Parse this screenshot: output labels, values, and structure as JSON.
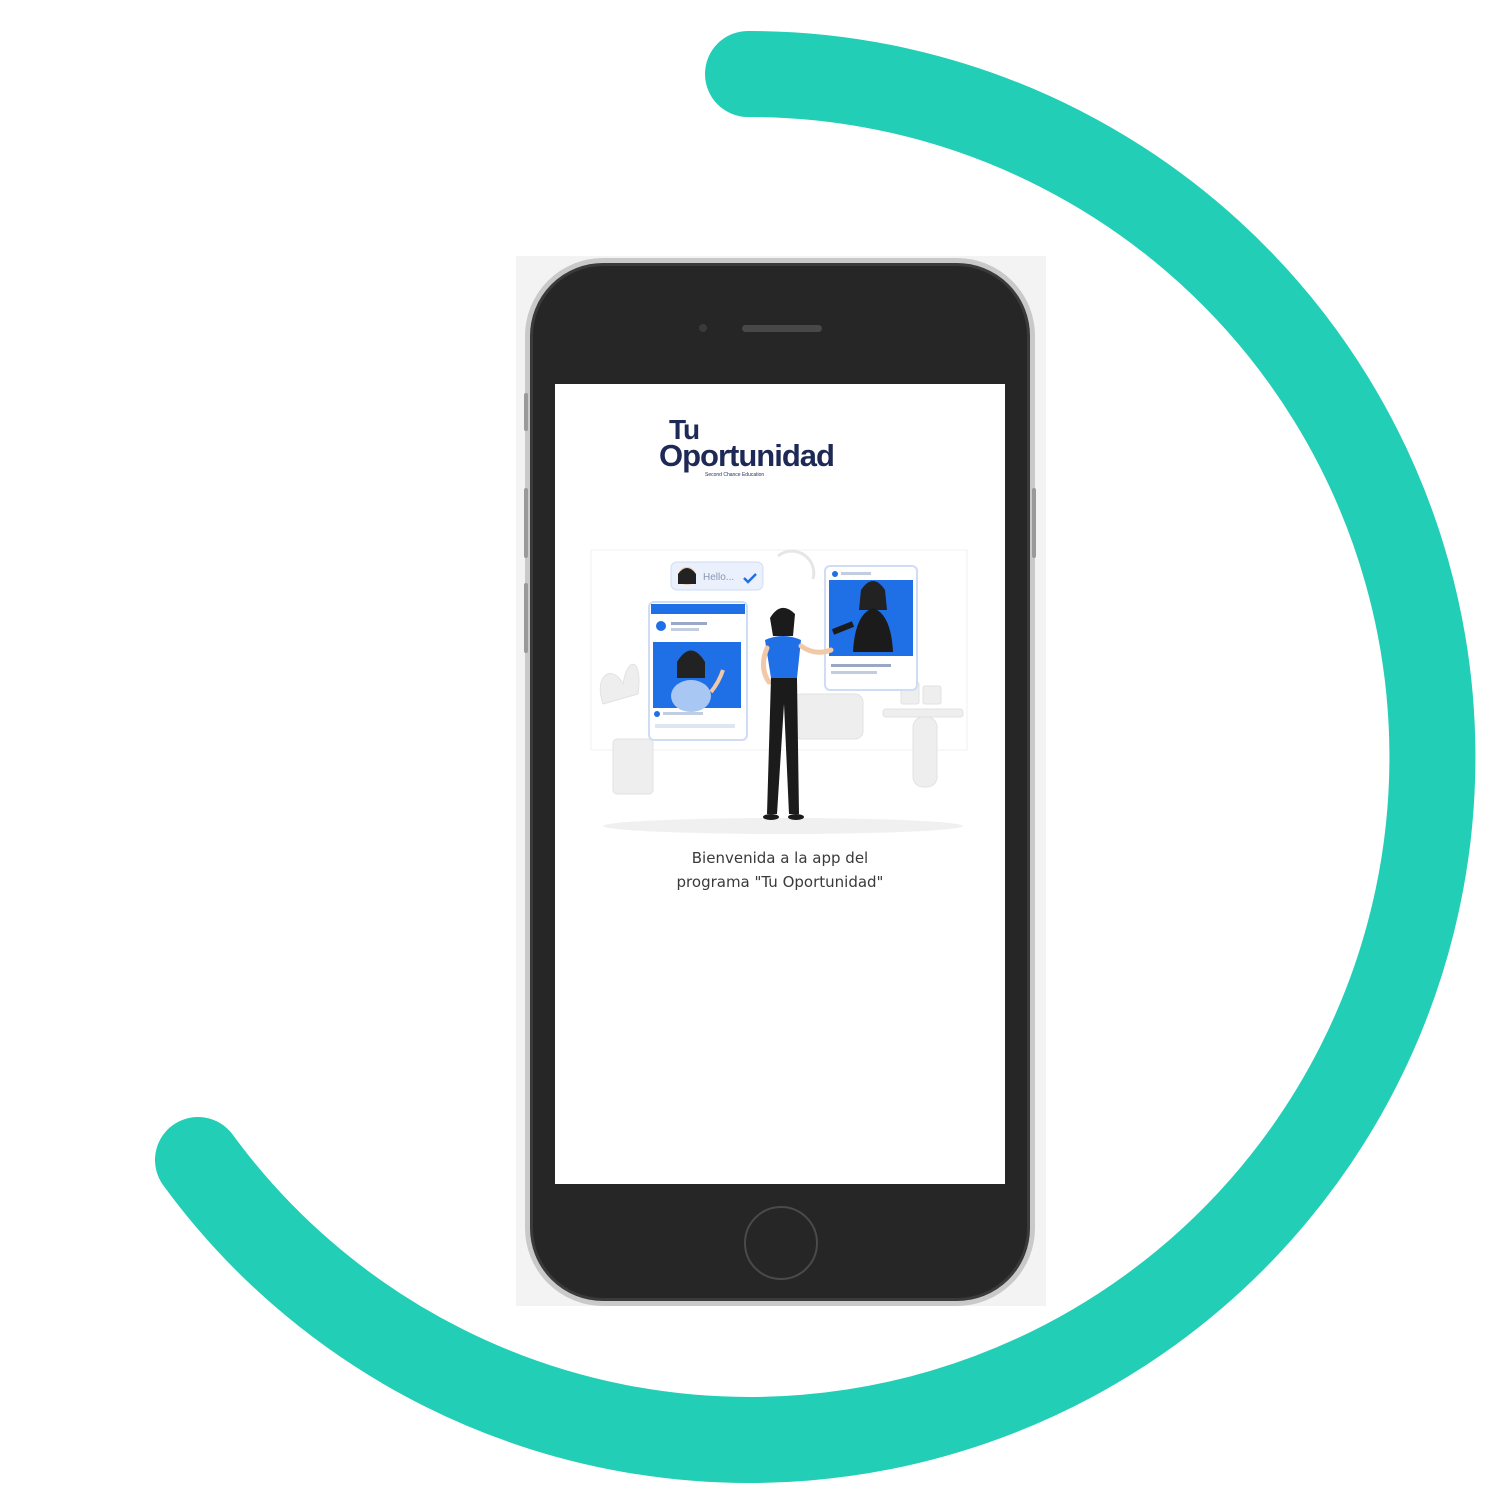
{
  "colors": {
    "accent_arc": "#22ceb5",
    "brand_navy": "#1e2a55",
    "illustration_blue": "#1f6fe6",
    "phone_body": "#262626"
  },
  "logo": {
    "line1": "Tu",
    "line2": "Oportunidad",
    "tagline": "Second Chance Education"
  },
  "illustration": {
    "chat_bubble_text": "Hello...",
    "icons": [
      "profile-card-left",
      "profile-card-right",
      "chat-bubble",
      "woman-presenting"
    ]
  },
  "welcome": {
    "line1": "Bienvenida a la app del",
    "line2": "programa \"Tu Oportunidad\""
  }
}
